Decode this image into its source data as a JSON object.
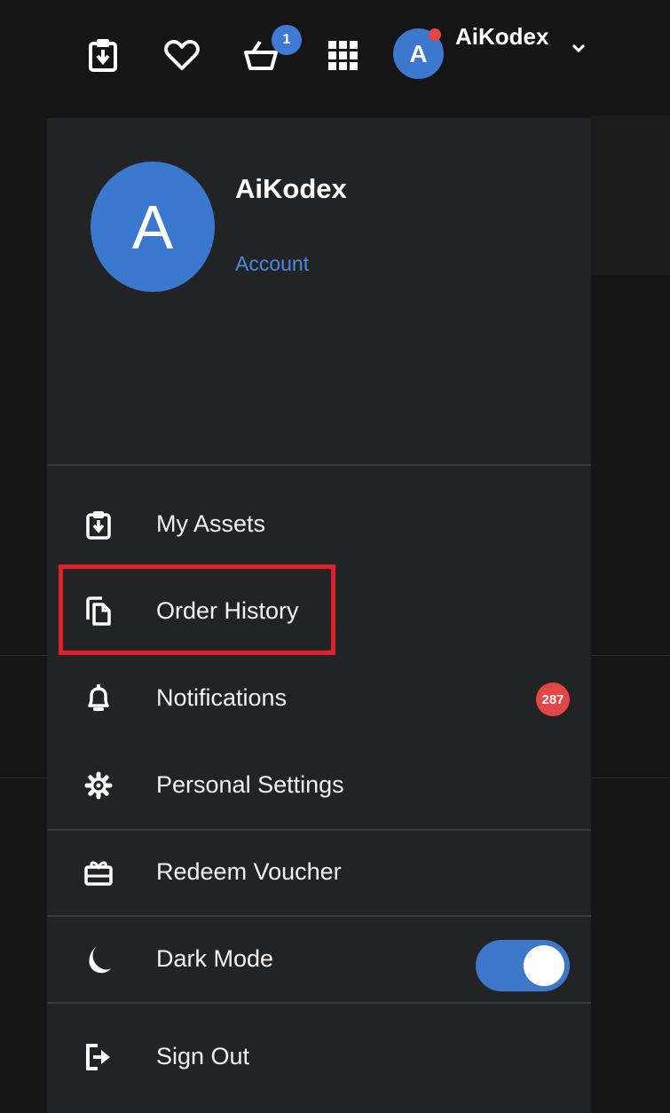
{
  "topbar": {
    "icons": [
      "my-assets-icon",
      "heart-icon",
      "cart-icon",
      "grid-icon"
    ],
    "cart_count": "1",
    "avatar_letter": "A",
    "username": "AiKodex",
    "status_dot_color": "#e64545"
  },
  "profile": {
    "avatar_letter": "A",
    "name": "AiKodex",
    "account_link": "Account",
    "avatar_color": "#3a78cf"
  },
  "menu": {
    "items": [
      {
        "label": "My Assets",
        "icon": "my-assets-icon"
      },
      {
        "label": "Order History",
        "icon": "order-history-icon"
      },
      {
        "label": "Notifications",
        "icon": "bell-icon",
        "badge": "287"
      },
      {
        "label": "Personal Settings",
        "icon": "gear-icon"
      },
      {
        "label": "Redeem Voucher",
        "icon": "voucher-icon"
      },
      {
        "label": "Dark Mode",
        "icon": "moon-icon",
        "toggle_on": true
      },
      {
        "label": "Sign Out",
        "icon": "sign-out-icon"
      }
    ],
    "highlighted_item": "Order History",
    "highlight_color": "#e0202a",
    "accent_color": "#3c77cc"
  }
}
